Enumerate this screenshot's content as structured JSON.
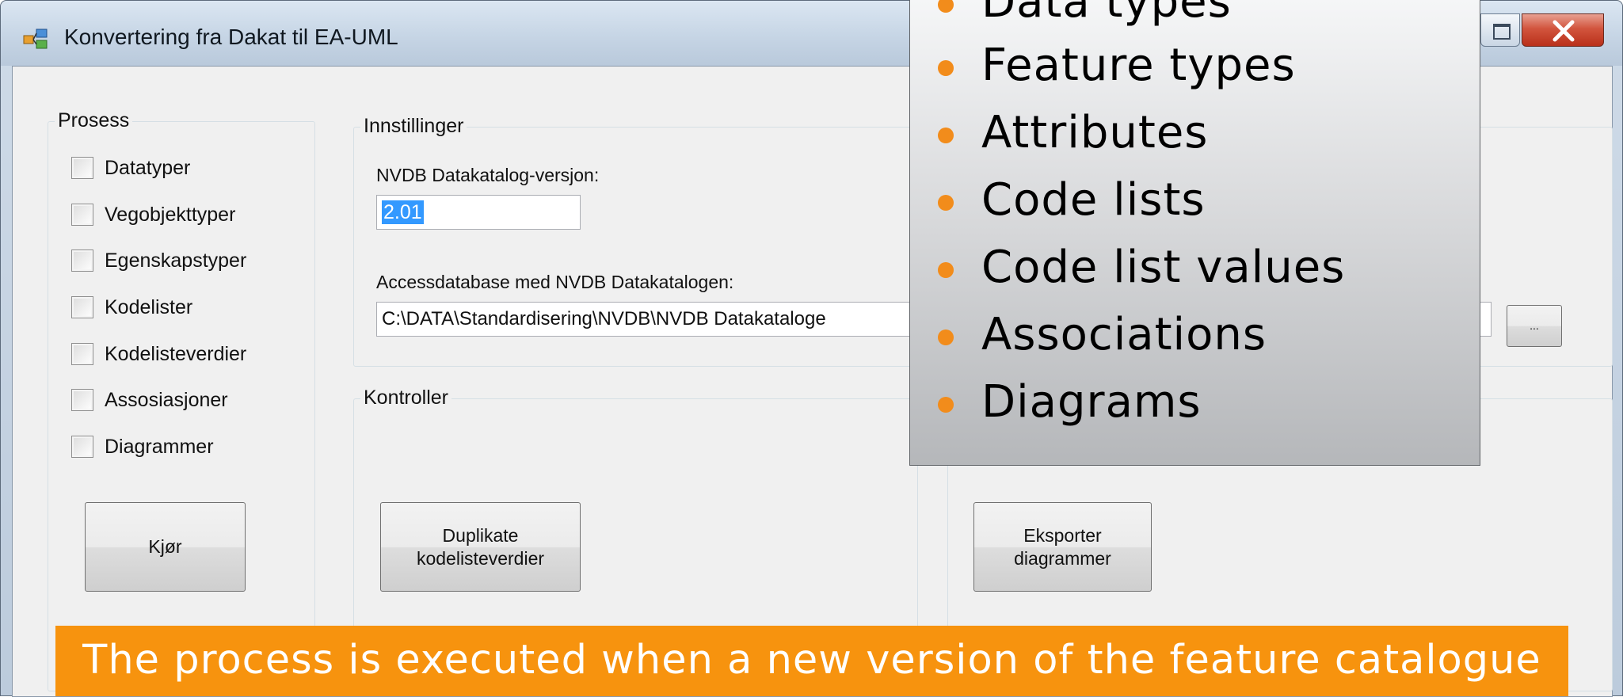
{
  "window": {
    "title": "Konvertering fra Dakat til EA-UML",
    "close_label": "X"
  },
  "prosess": {
    "legend": "Prosess",
    "checkboxes": [
      {
        "label": "Datatyper",
        "checked": false
      },
      {
        "label": "Vegobjekttyper",
        "checked": false
      },
      {
        "label": "Egenskapstyper",
        "checked": false
      },
      {
        "label": "Kodelister",
        "checked": false
      },
      {
        "label": "Kodelisteverdier",
        "checked": false
      },
      {
        "label": "Assosiasjoner",
        "checked": false
      },
      {
        "label": "Diagrammer",
        "checked": false
      }
    ],
    "run_button": "Kjør"
  },
  "innstillinger": {
    "legend": "Innstillinger",
    "version_label": "NVDB Datakatalog-versjon:",
    "version_value": "2.01",
    "access_label": "Accessdatabase med NVDB Datakatalogen:",
    "access_value": "C:\\DATA\\Standardisering\\NVDB\\NVDB Datakataloge",
    "browse_label": "..."
  },
  "kontroller": {
    "legend": "Kontroller",
    "dup_button_line1": "Duplikate",
    "dup_button_line2": "kodelisteverdier"
  },
  "export": {
    "button_line1": "Eksporter",
    "button_line2": "diagrammer"
  },
  "overlay": {
    "bullets": [
      "Data types",
      "Feature types",
      "Attributes",
      "Code lists",
      "Code list values",
      "Associations",
      "Diagrams"
    ],
    "bullet_color": "#f28c1b",
    "banner_text": "The process is executed when a new version of the feature catalogue",
    "banner_color": "#f7930e"
  }
}
